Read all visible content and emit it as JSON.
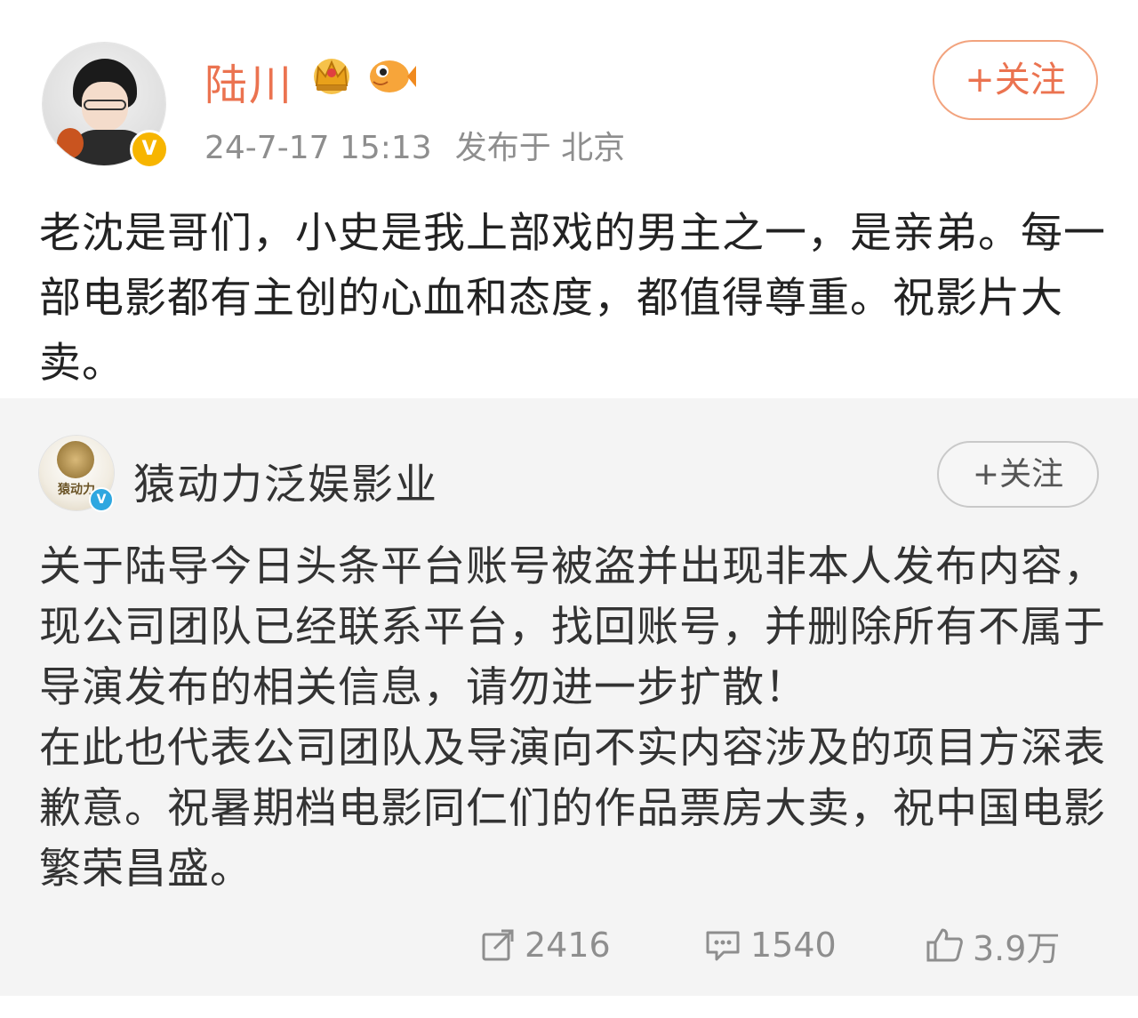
{
  "post": {
    "username": "陆川",
    "timestamp": "24-7-17 15:13",
    "location": "发布于 北京",
    "follow_label": "+关注",
    "text": "老沈是哥们，小史是我上部戏的男主之一，是亲弟。每一部电影都有主创的心血和态度，都值得尊重。祝影片大卖。",
    "badges": [
      "crown-icon",
      "fish-icon"
    ],
    "verified_color": "#f7b500"
  },
  "repost": {
    "username": "猿动力泛娱影业",
    "follow_label": "+关注",
    "avatar_text": "猿动力",
    "paragraphs": [
      "关于陆导今日头条平台账号被盗并出现非本人发布内容，现公司团队已经联系平台，找回账号，并删除所有不属于导演发布的相关信息，请勿进一步扩散！",
      "在此也代表公司团队及导演向不实内容涉及的项目方深表歉意。祝暑期档电影同仁们的作品票房大卖，祝中国电影繁荣昌盛。"
    ],
    "verified_color": "#2ea7e0"
  },
  "actions": {
    "share_count": "2416",
    "comment_count": "1540",
    "like_count": "3.9万"
  },
  "colors": {
    "accent": "#eb7350",
    "meta_gray": "#8e8e8e",
    "card_bg": "#f4f4f4"
  }
}
